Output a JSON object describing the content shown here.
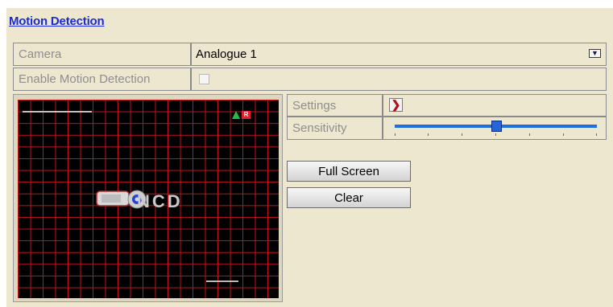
{
  "header": {
    "title": "Motion Detection"
  },
  "camera": {
    "label": "Camera",
    "value": "Analogue 1"
  },
  "enable_motion": {
    "label": "Enable Motion Detection",
    "checked": false
  },
  "preview": {
    "watermark": "NCD",
    "alarm_badges": [
      "A",
      "R"
    ]
  },
  "settings": {
    "label": "Settings"
  },
  "sensitivity": {
    "label": "Sensitivity",
    "level_fraction": 0.5,
    "levels": 6
  },
  "buttons": {
    "full_screen": "Full Screen",
    "clear": "Clear"
  },
  "colors": {
    "accent": "#1b2ad6",
    "grid": "#c4121c",
    "panel": "#ede7cf",
    "slider": "#1f6fe0"
  }
}
